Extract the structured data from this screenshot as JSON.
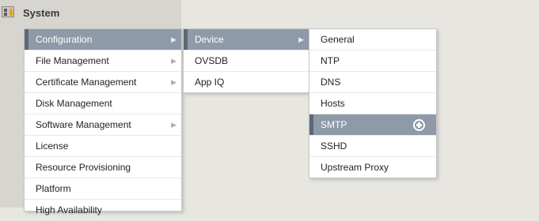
{
  "header": {
    "title": "System",
    "icon": "system-icon"
  },
  "menu1": {
    "items": [
      {
        "label": "Configuration",
        "active": true,
        "submenu": true
      },
      {
        "label": "File Management",
        "submenu": true
      },
      {
        "label": "Certificate Management",
        "submenu": true
      },
      {
        "label": "Disk Management",
        "submenu": false
      },
      {
        "label": "Software Management",
        "submenu": true
      },
      {
        "label": "License",
        "submenu": false
      },
      {
        "label": "Resource Provisioning",
        "submenu": false
      },
      {
        "label": "Platform",
        "submenu": false
      },
      {
        "label": "High Availability",
        "submenu": false
      }
    ]
  },
  "menu2": {
    "items": [
      {
        "label": "Device",
        "active": true,
        "submenu": true
      },
      {
        "label": "OVSDB"
      },
      {
        "label": "App IQ"
      }
    ]
  },
  "menu3": {
    "items": [
      {
        "label": "General"
      },
      {
        "label": "NTP"
      },
      {
        "label": "DNS"
      },
      {
        "label": "Hosts"
      },
      {
        "label": "SMTP",
        "active": true
      },
      {
        "label": "SSHD"
      },
      {
        "label": "Upstream Proxy"
      }
    ]
  },
  "colors": {
    "active_bg": "#8e9aa8",
    "active_stripe": "#5c6878",
    "panel_bg": "#d7d5d0"
  }
}
